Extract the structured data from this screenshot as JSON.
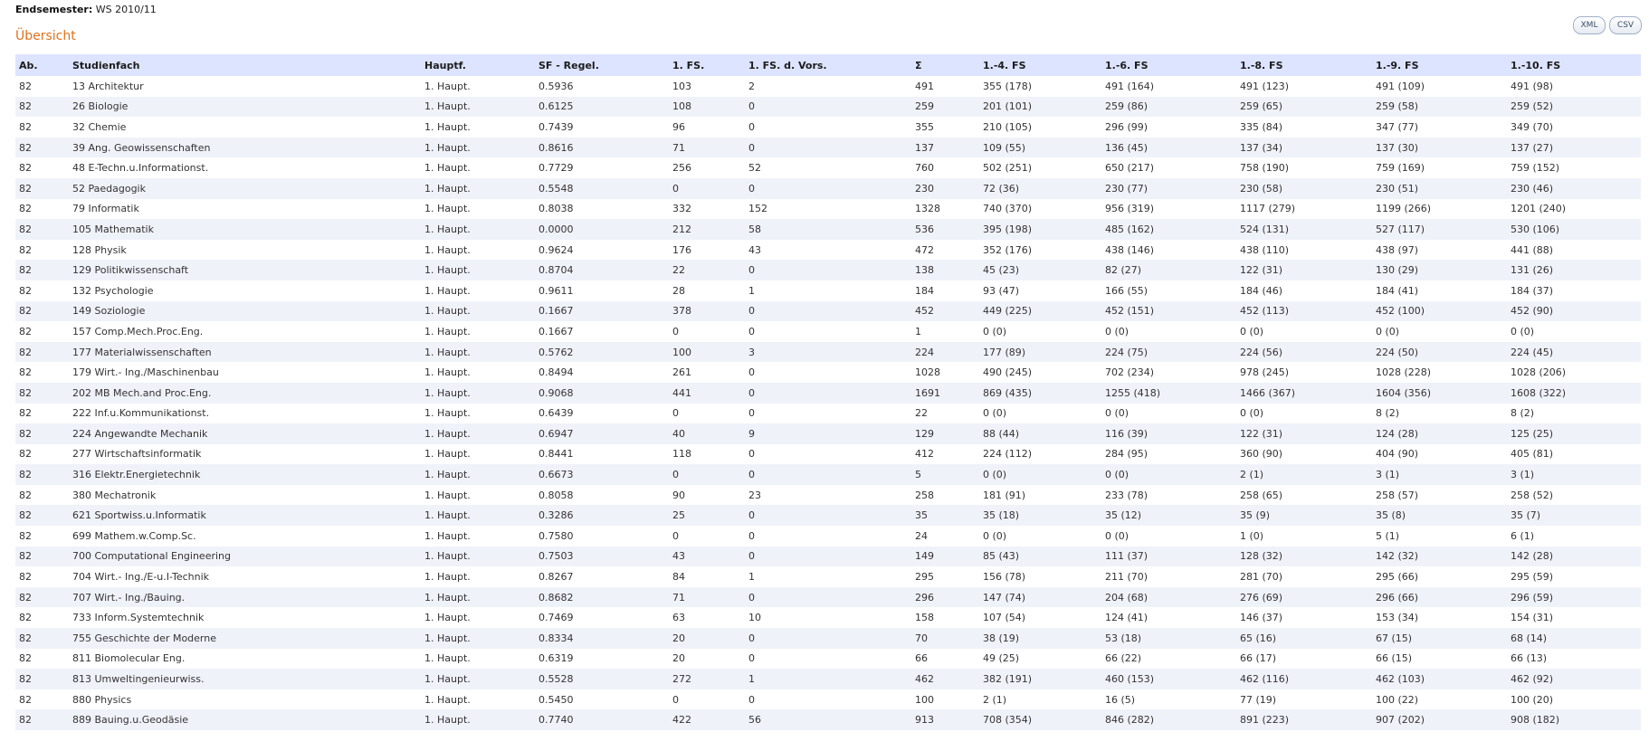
{
  "header": {
    "endsemester_label": "Endsemester:",
    "endsemester_value": "WS 2010/11",
    "section_title": "Übersicht"
  },
  "export": {
    "xml_label": "XML",
    "csv_label": "CSV"
  },
  "colors": {
    "title": "#e0711b",
    "header_bg": "#dde4ff",
    "row_alt_bg": "#f0f2fa"
  },
  "table": {
    "columns": [
      "Ab.",
      "Studienfach",
      "Hauptf.",
      "SF - Regel.",
      "1. FS.",
      "1. FS. d. Vors.",
      "Σ",
      "1.-4. FS",
      "1.-6. FS",
      "1.-8. FS",
      "1.-9. FS",
      "1.-10. FS"
    ],
    "rows": [
      [
        "82",
        "13 Architektur",
        "1. Haupt.",
        "0.5936",
        "103",
        "2",
        "491",
        "355 (178)",
        "491 (164)",
        "491 (123)",
        "491 (109)",
        "491 (98)"
      ],
      [
        "82",
        "26 Biologie",
        "1. Haupt.",
        "0.6125",
        "108",
        "0",
        "259",
        "201 (101)",
        "259 (86)",
        "259 (65)",
        "259 (58)",
        "259 (52)"
      ],
      [
        "82",
        "32 Chemie",
        "1. Haupt.",
        "0.7439",
        "96",
        "0",
        "355",
        "210 (105)",
        "296 (99)",
        "335 (84)",
        "347 (77)",
        "349 (70)"
      ],
      [
        "82",
        "39 Ang. Geowissenschaften",
        "1. Haupt.",
        "0.8616",
        "71",
        "0",
        "137",
        "109 (55)",
        "136 (45)",
        "137 (34)",
        "137 (30)",
        "137 (27)"
      ],
      [
        "82",
        "48 E-Techn.u.Informationst.",
        "1. Haupt.",
        "0.7729",
        "256",
        "52",
        "760",
        "502 (251)",
        "650 (217)",
        "758 (190)",
        "759 (169)",
        "759 (152)"
      ],
      [
        "82",
        "52 Paedagogik",
        "1. Haupt.",
        "0.5548",
        "0",
        "0",
        "230",
        "72 (36)",
        "230 (77)",
        "230 (58)",
        "230 (51)",
        "230 (46)"
      ],
      [
        "82",
        "79 Informatik",
        "1. Haupt.",
        "0.8038",
        "332",
        "152",
        "1328",
        "740 (370)",
        "956 (319)",
        "1117 (279)",
        "1199 (266)",
        "1201 (240)"
      ],
      [
        "82",
        "105 Mathematik",
        "1. Haupt.",
        "0.0000",
        "212",
        "58",
        "536",
        "395 (198)",
        "485 (162)",
        "524 (131)",
        "527 (117)",
        "530 (106)"
      ],
      [
        "82",
        "128 Physik",
        "1. Haupt.",
        "0.9624",
        "176",
        "43",
        "472",
        "352 (176)",
        "438 (146)",
        "438 (110)",
        "438 (97)",
        "441 (88)"
      ],
      [
        "82",
        "129 Politikwissenschaft",
        "1. Haupt.",
        "0.8704",
        "22",
        "0",
        "138",
        "45 (23)",
        "82 (27)",
        "122 (31)",
        "130 (29)",
        "131 (26)"
      ],
      [
        "82",
        "132 Psychologie",
        "1. Haupt.",
        "0.9611",
        "28",
        "1",
        "184",
        "93 (47)",
        "166 (55)",
        "184 (46)",
        "184 (41)",
        "184 (37)"
      ],
      [
        "82",
        "149 Soziologie",
        "1. Haupt.",
        "0.1667",
        "378",
        "0",
        "452",
        "449 (225)",
        "452 (151)",
        "452 (113)",
        "452 (100)",
        "452 (90)"
      ],
      [
        "82",
        "157 Comp.Mech.Proc.Eng.",
        "1. Haupt.",
        "0.1667",
        "0",
        "0",
        "1",
        "0 (0)",
        "0 (0)",
        "0 (0)",
        "0 (0)",
        "0 (0)"
      ],
      [
        "82",
        "177 Materialwissenschaften",
        "1. Haupt.",
        "0.5762",
        "100",
        "3",
        "224",
        "177 (89)",
        "224 (75)",
        "224 (56)",
        "224 (50)",
        "224 (45)"
      ],
      [
        "82",
        "179 Wirt.- Ing./Maschinenbau",
        "1. Haupt.",
        "0.8494",
        "261",
        "0",
        "1028",
        "490 (245)",
        "702 (234)",
        "978 (245)",
        "1028 (228)",
        "1028 (206)"
      ],
      [
        "82",
        "202 MB Mech.and Proc.Eng.",
        "1. Haupt.",
        "0.9068",
        "441",
        "0",
        "1691",
        "869 (435)",
        "1255 (418)",
        "1466 (367)",
        "1604 (356)",
        "1608 (322)"
      ],
      [
        "82",
        "222 Inf.u.Kommunikationst.",
        "1. Haupt.",
        "0.6439",
        "0",
        "0",
        "22",
        "0 (0)",
        "0 (0)",
        "0 (0)",
        "8 (2)",
        "8 (2)"
      ],
      [
        "82",
        "224 Angewandte Mechanik",
        "1. Haupt.",
        "0.6947",
        "40",
        "9",
        "129",
        "88 (44)",
        "116 (39)",
        "122 (31)",
        "124 (28)",
        "125 (25)"
      ],
      [
        "82",
        "277 Wirtschaftsinformatik",
        "1. Haupt.",
        "0.8441",
        "118",
        "0",
        "412",
        "224 (112)",
        "284 (95)",
        "360 (90)",
        "404 (90)",
        "405 (81)"
      ],
      [
        "82",
        "316 Elektr.Energietechnik",
        "1. Haupt.",
        "0.6673",
        "0",
        "0",
        "5",
        "0 (0)",
        "0 (0)",
        "2 (1)",
        "3 (1)",
        "3 (1)"
      ],
      [
        "82",
        "380 Mechatronik",
        "1. Haupt.",
        "0.8058",
        "90",
        "23",
        "258",
        "181 (91)",
        "233 (78)",
        "258 (65)",
        "258 (57)",
        "258 (52)"
      ],
      [
        "82",
        "621 Sportwiss.u.Informatik",
        "1. Haupt.",
        "0.3286",
        "25",
        "0",
        "35",
        "35 (18)",
        "35 (12)",
        "35 (9)",
        "35 (8)",
        "35 (7)"
      ],
      [
        "82",
        "699 Mathem.w.Comp.Sc.",
        "1. Haupt.",
        "0.7580",
        "0",
        "0",
        "24",
        "0 (0)",
        "0 (0)",
        "1 (0)",
        "5 (1)",
        "6 (1)"
      ],
      [
        "82",
        "700 Computational Engineering",
        "1. Haupt.",
        "0.7503",
        "43",
        "0",
        "149",
        "85 (43)",
        "111 (37)",
        "128 (32)",
        "142 (32)",
        "142 (28)"
      ],
      [
        "82",
        "704 Wirt.- Ing./E-u.I-Technik",
        "1. Haupt.",
        "0.8267",
        "84",
        "1",
        "295",
        "156 (78)",
        "211 (70)",
        "281 (70)",
        "295 (66)",
        "295 (59)"
      ],
      [
        "82",
        "707 Wirt.- Ing./Bauing.",
        "1. Haupt.",
        "0.8682",
        "71",
        "0",
        "296",
        "147 (74)",
        "204 (68)",
        "276 (69)",
        "296 (66)",
        "296 (59)"
      ],
      [
        "82",
        "733 Inform.Systemtechnik",
        "1. Haupt.",
        "0.7469",
        "63",
        "10",
        "158",
        "107 (54)",
        "124 (41)",
        "146 (37)",
        "153 (34)",
        "154 (31)"
      ],
      [
        "82",
        "755 Geschichte der Moderne",
        "1. Haupt.",
        "0.8334",
        "20",
        "0",
        "70",
        "38 (19)",
        "53 (18)",
        "65 (16)",
        "67 (15)",
        "68 (14)"
      ],
      [
        "82",
        "811 Biomolecular Eng.",
        "1. Haupt.",
        "0.6319",
        "20",
        "0",
        "66",
        "49 (25)",
        "66 (22)",
        "66 (17)",
        "66 (15)",
        "66 (13)"
      ],
      [
        "82",
        "813 Umweltingenieurwiss.",
        "1. Haupt.",
        "0.5528",
        "272",
        "1",
        "462",
        "382 (191)",
        "460 (153)",
        "462 (116)",
        "462 (103)",
        "462 (92)"
      ],
      [
        "82",
        "880 Physics",
        "1. Haupt.",
        "0.5450",
        "0",
        "0",
        "100",
        "2 (1)",
        "16 (5)",
        "77 (19)",
        "100 (22)",
        "100 (20)"
      ],
      [
        "82",
        "889 Bauing.u.Geodäsie",
        "1. Haupt.",
        "0.7740",
        "422",
        "56",
        "913",
        "708 (354)",
        "846 (282)",
        "891 (223)",
        "907 (202)",
        "908 (182)"
      ]
    ]
  }
}
